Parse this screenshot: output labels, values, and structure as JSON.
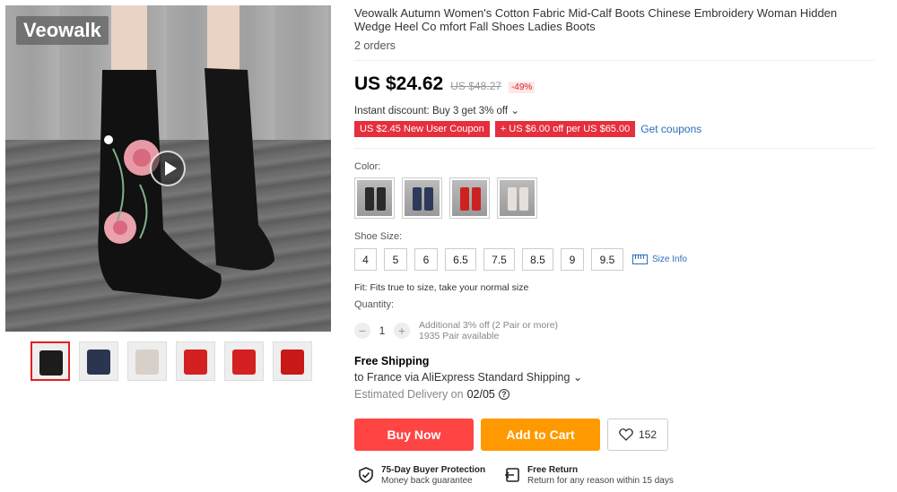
{
  "gallery": {
    "brand": "Veowalk",
    "thumbnails": [
      {
        "color": "#1c1c1c"
      },
      {
        "color": "#2a3550"
      },
      {
        "color": "#d8d0c8"
      },
      {
        "color": "#d42020"
      },
      {
        "color": "#d42020"
      },
      {
        "color": "#c81818"
      }
    ]
  },
  "product": {
    "title": "Veowalk Autumn Women's Cotton Fabric Mid-Calf Boots Chinese Embroidery Woman Hidden Wedge Heel Co mfort Fall Shoes Ladies Boots",
    "orders": "2 orders",
    "price_now": "US $24.62",
    "price_old": "US $48.27",
    "discount": "-49%",
    "instant_discount": "Instant discount: Buy 3 get 3% off ⌄",
    "coupons": [
      "US $2.45 New User Coupon",
      "+ US $6.00 off per US $65.00"
    ],
    "get_coupons": "Get coupons"
  },
  "options": {
    "color_label": "Color:",
    "colors": [
      {
        "color": "#2a2a2a"
      },
      {
        "color": "#2d3a5a"
      },
      {
        "color": "#cc2222"
      },
      {
        "color": "#e6e0da"
      }
    ],
    "size_label": "Shoe Size:",
    "sizes": [
      "4",
      "5",
      "6",
      "6.5",
      "7.5",
      "8.5",
      "9",
      "9.5"
    ],
    "size_info": "Size Info",
    "fit": "Fit: Fits true to size, take your normal size",
    "quantity_label": "Quantity:",
    "quantity_value": "1",
    "qty_note_1": "Additional 3% off (2 Pair or more)",
    "qty_note_2": "1935 Pair available"
  },
  "shipping": {
    "title": "Free Shipping",
    "via": "to France via AliExpress Standard Shipping ⌄",
    "est_label": "Estimated Delivery on",
    "est_date": "02/05"
  },
  "actions": {
    "buy_now": "Buy Now",
    "add_to_cart": "Add to Cart",
    "wishlist_count": "152"
  },
  "guarantees": {
    "protection_title": "75-Day Buyer Protection",
    "protection_sub": "Money back guarantee",
    "return_title": "Free Return",
    "return_sub": "Return for any reason within 15 days"
  }
}
